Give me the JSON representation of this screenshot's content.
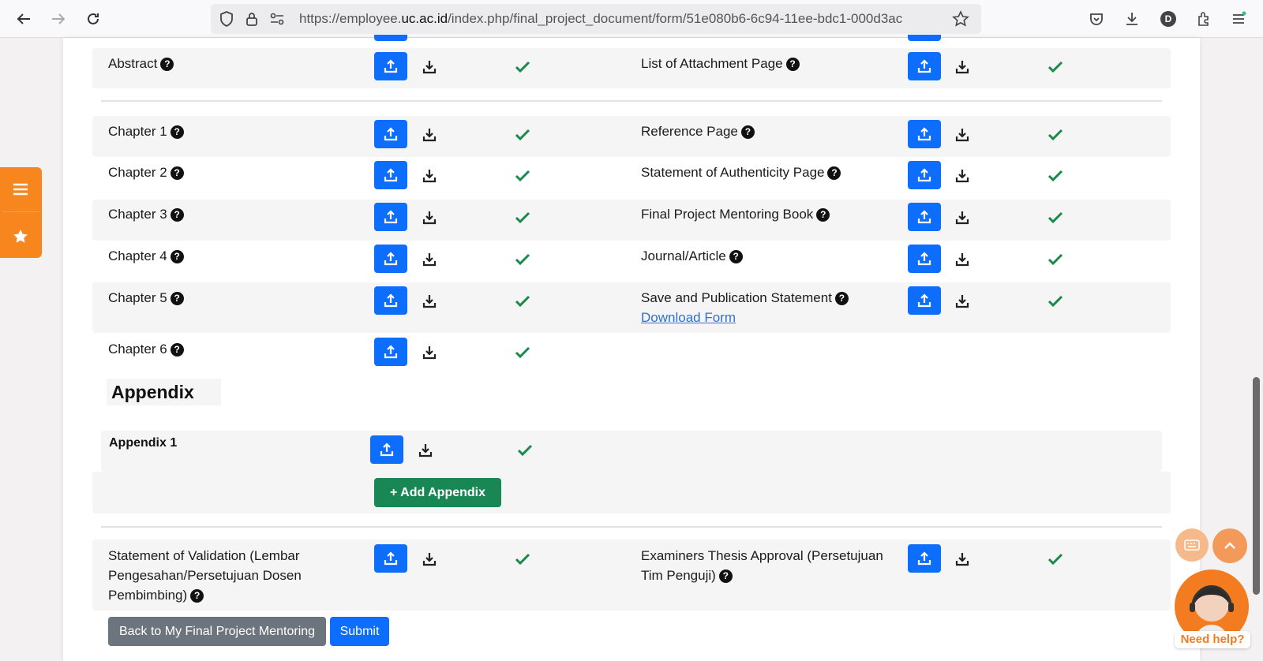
{
  "browser": {
    "url_prefix": "https://employee.",
    "url_domain": "uc.ac.id",
    "url_rest": "/index.php/final_project_document/form/51e080b6-6c94-11ee-bdc1-000d3ac",
    "profile_initial": "D"
  },
  "documents_top": [
    {
      "left_label": "Abstract",
      "right_label": "List of Attachment Page"
    }
  ],
  "documents_main": [
    {
      "left_label": "Chapter 1",
      "right_label": "Reference Page"
    },
    {
      "left_label": "Chapter 2",
      "right_label": "Statement of Authenticity Page"
    },
    {
      "left_label": "Chapter 3",
      "right_label": "Final Project Mentoring Book"
    },
    {
      "left_label": "Chapter 4",
      "right_label": "Journal/Article"
    },
    {
      "left_label": "Chapter 5",
      "right_label": "Save and Publication Statement",
      "right_link": "Download Form"
    },
    {
      "left_label": "Chapter 6"
    }
  ],
  "appendix": {
    "heading": "Appendix",
    "item_label": "Appendix 1",
    "add_button": "+ Add Appendix"
  },
  "final_docs": {
    "left_line1": "Statement of Validation (Lembar",
    "left_line2": "Pengesahan/Persetujuan Dosen",
    "left_line3": "Pembimbing)",
    "right_line1": "Examiners Thesis Approval (Persetujuan",
    "right_line2": "Tim Penguji)"
  },
  "actions": {
    "back": "Back to My Final Project Mentoring",
    "submit": "Submit"
  },
  "help": {
    "label": "Need help?"
  },
  "colors": {
    "primary": "#0d6efd",
    "success": "#198754",
    "check": "#1a8a4a",
    "orange": "#f7861f",
    "secondary": "#6c757d"
  }
}
